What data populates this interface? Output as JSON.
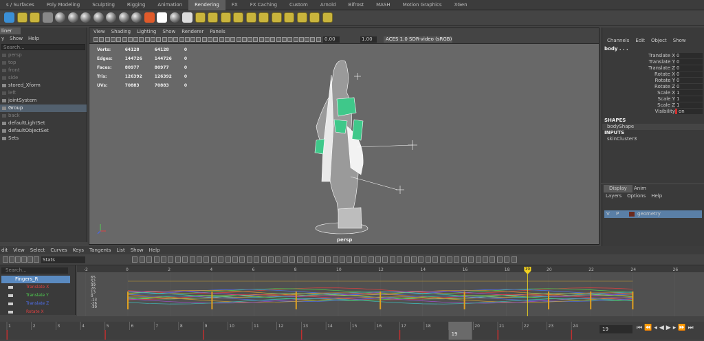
{
  "shelf_tabs": [
    "s / Surfaces",
    "Poly Modeling",
    "Sculpting",
    "Rigging",
    "Animation",
    "Rendering",
    "FX",
    "FX Caching",
    "Custom",
    "Arnold",
    "Bifrost",
    "MASH",
    "Motion Graphics",
    "XGen"
  ],
  "active_tab": "Rendering",
  "outliner": {
    "title": "liner",
    "menu": [
      "y",
      "Show",
      "Help"
    ],
    "search": "Search...",
    "items": [
      {
        "label": "persp",
        "dim": true,
        "icon": "camera-icon"
      },
      {
        "label": "top",
        "dim": true,
        "icon": "camera-icon"
      },
      {
        "label": "front",
        "dim": true,
        "icon": "camera-icon"
      },
      {
        "label": "side",
        "dim": true,
        "icon": "camera-icon"
      },
      {
        "label": "stored_Xform",
        "dim": false,
        "icon": "transform-icon"
      },
      {
        "label": "left",
        "dim": true,
        "icon": "camera-icon"
      },
      {
        "label": "jointSystem",
        "dim": false,
        "icon": "joint-icon"
      },
      {
        "label": "Group",
        "dim": false,
        "sel": true,
        "icon": "group-icon"
      },
      {
        "label": "back",
        "dim": true,
        "icon": "camera-icon"
      },
      {
        "label": "defaultLightSet",
        "dim": false,
        "icon": "set-icon"
      },
      {
        "label": "defaultObjectSet",
        "dim": false,
        "icon": "set-icon"
      },
      {
        "label": "Sets",
        "dim": false,
        "icon": "set-icon"
      }
    ]
  },
  "viewport": {
    "menu": [
      "View",
      "Shading",
      "Lighting",
      "Show",
      "Renderer",
      "Panels"
    ],
    "field1": "0.00",
    "field2": "1.00",
    "colorspace": "ACES 1.0 SDR-video (sRGB)",
    "camera": "persp",
    "stats": [
      [
        "Verts:",
        "64128",
        "64128",
        "0"
      ],
      [
        "Edges:",
        "144726",
        "144726",
        "0"
      ],
      [
        "Faces:",
        "80977",
        "80977",
        "0"
      ],
      [
        "Tris:",
        "126392",
        "126392",
        "0"
      ],
      [
        "UVs:",
        "70883",
        "70883",
        "0"
      ]
    ]
  },
  "channel_box": {
    "menu": [
      "Channels",
      "Edit",
      "Object",
      "Show"
    ],
    "object": "body . . .",
    "attrs": [
      [
        "Translate X",
        "0"
      ],
      [
        "Translate Y",
        "0"
      ],
      [
        "Translate Z",
        "0"
      ],
      [
        "Rotate X",
        "0"
      ],
      [
        "Rotate Y",
        "0"
      ],
      [
        "Rotate Z",
        "0"
      ],
      [
        "Scale X",
        "1"
      ],
      [
        "Scale Y",
        "1"
      ],
      [
        "Scale Z",
        "1"
      ],
      [
        "Visibility",
        "on"
      ]
    ],
    "shapes_label": "SHAPES",
    "shape": "bodyShape",
    "inputs_label": "INPUTS",
    "input": "skinCluster3"
  },
  "layers": {
    "tabs": [
      "Display",
      "Anim"
    ],
    "menu": [
      "Layers",
      "Options",
      "Help"
    ],
    "v": "V",
    "p": "P",
    "layer": "geometry"
  },
  "graph_editor": {
    "menu": [
      "dit",
      "View",
      "Select",
      "Curves",
      "Keys",
      "Tangents",
      "List",
      "Show",
      "Help"
    ],
    "stats_label": "Stats",
    "search": "Search...",
    "node": "Fingers_R",
    "curves": [
      {
        "label": "Translate X",
        "color": "#e04040"
      },
      {
        "label": "Translate Y",
        "color": "#50d050"
      },
      {
        "label": "Translate Z",
        "color": "#5070f0"
      },
      {
        "label": "Rotate X",
        "color": "#e04040"
      }
    ],
    "yticks": [
      "65",
      "52",
      "39",
      "26",
      "13",
      "0",
      "-13",
      "-26",
      "-39"
    ],
    "xticks": [
      "-2",
      "0",
      "2",
      "4",
      "6",
      "8",
      "10",
      "12",
      "14",
      "16",
      "18",
      "19",
      "20",
      "22",
      "24",
      "26"
    ],
    "current_frame": "19"
  },
  "timeline": {
    "ticks": [
      "1",
      "2",
      "3",
      "4",
      "5",
      "6",
      "7",
      "8",
      "9",
      "10",
      "11",
      "12",
      "13",
      "14",
      "15",
      "16",
      "17",
      "18",
      "19",
      "20",
      "21",
      "22",
      "23",
      "24"
    ],
    "current": "19",
    "frame_field": "19"
  }
}
